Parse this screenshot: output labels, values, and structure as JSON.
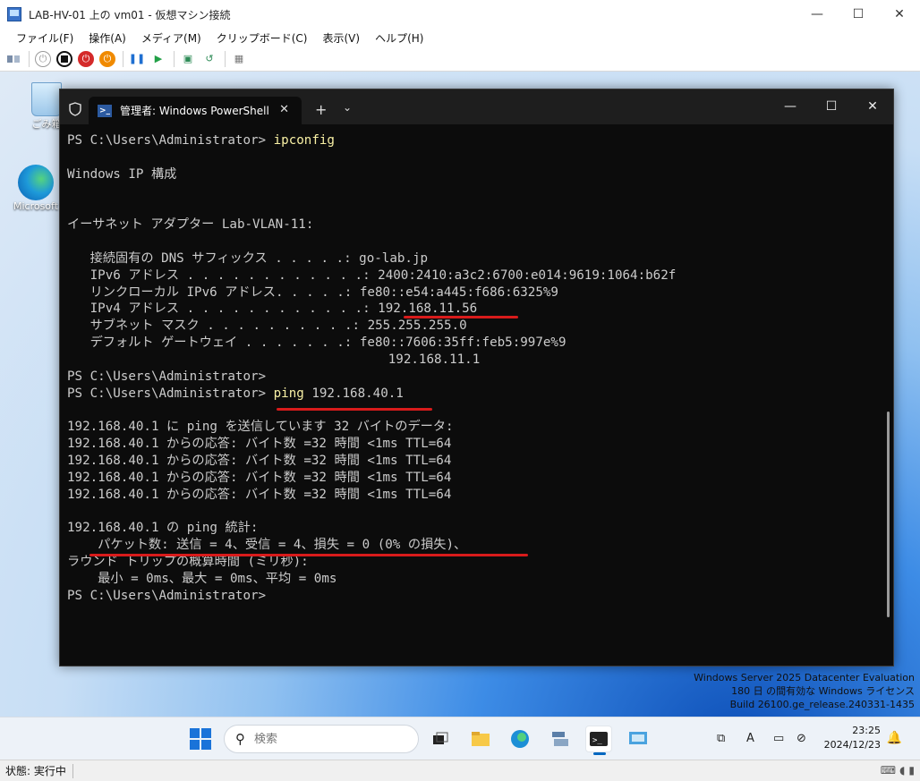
{
  "vm_window": {
    "title": "LAB-HV-01 上の vm01 - 仮想マシン接続",
    "minimize": "—",
    "maximize": "☐",
    "close": "✕",
    "menu": [
      "ファイル(F)",
      "操作(A)",
      "メディア(M)",
      "クリップボード(C)",
      "表示(V)",
      "ヘルプ(H)"
    ]
  },
  "desktop": {
    "recycle_bin_label": "ごみ箱",
    "edge_label": "Microsoft"
  },
  "terminal": {
    "tab_title": "管理者: Windows PowerShell",
    "tab_close": "✕",
    "new_tab": "+",
    "dropdown": "⌄",
    "lines": [
      {
        "prompt": "PS C:\\Users\\Administrator> ",
        "cmd": "ipconfig",
        "rest": ""
      },
      {
        "prompt": "",
        "cmd": "",
        "rest": ""
      },
      {
        "prompt": "",
        "cmd": "",
        "rest": "Windows IP 構成"
      },
      {
        "prompt": "",
        "cmd": "",
        "rest": ""
      },
      {
        "prompt": "",
        "cmd": "",
        "rest": ""
      },
      {
        "prompt": "",
        "cmd": "",
        "rest": "イーサネット アダプター Lab-VLAN-11:"
      },
      {
        "prompt": "",
        "cmd": "",
        "rest": ""
      },
      {
        "prompt": "",
        "cmd": "",
        "rest": "   接続固有の DNS サフィックス . . . . .: go-lab.jp"
      },
      {
        "prompt": "",
        "cmd": "",
        "rest": "   IPv6 アドレス . . . . . . . . . . . .: 2400:2410:a3c2:6700:e014:9619:1064:b62f"
      },
      {
        "prompt": "",
        "cmd": "",
        "rest": "   リンクローカル IPv6 アドレス. . . . .: fe80::e54:a445:f686:6325%9"
      },
      {
        "prompt": "",
        "cmd": "",
        "rest": "   IPv4 アドレス . . . . . . . . . . . .: 192.168.11.56"
      },
      {
        "prompt": "",
        "cmd": "",
        "rest": "   サブネット マスク . . . . . . . . . .: 255.255.255.0"
      },
      {
        "prompt": "",
        "cmd": "",
        "rest": "   デフォルト ゲートウェイ . . . . . . .: fe80::7606:35ff:feb5:997e%9"
      },
      {
        "prompt": "",
        "cmd": "",
        "rest": "                                          192.168.11.1"
      },
      {
        "prompt": "PS C:\\Users\\Administrator>",
        "cmd": "",
        "rest": ""
      },
      {
        "prompt": "PS C:\\Users\\Administrator> ",
        "cmd": "ping",
        "rest": " 192.168.40.1"
      },
      {
        "prompt": "",
        "cmd": "",
        "rest": ""
      },
      {
        "prompt": "",
        "cmd": "",
        "rest": "192.168.40.1 に ping を送信しています 32 バイトのデータ:"
      },
      {
        "prompt": "",
        "cmd": "",
        "rest": "192.168.40.1 からの応答: バイト数 =32 時間 <1ms TTL=64"
      },
      {
        "prompt": "",
        "cmd": "",
        "rest": "192.168.40.1 からの応答: バイト数 =32 時間 <1ms TTL=64"
      },
      {
        "prompt": "",
        "cmd": "",
        "rest": "192.168.40.1 からの応答: バイト数 =32 時間 <1ms TTL=64"
      },
      {
        "prompt": "",
        "cmd": "",
        "rest": "192.168.40.1 からの応答: バイト数 =32 時間 <1ms TTL=64"
      },
      {
        "prompt": "",
        "cmd": "",
        "rest": ""
      },
      {
        "prompt": "",
        "cmd": "",
        "rest": "192.168.40.1 の ping 統計:"
      },
      {
        "prompt": "",
        "cmd": "",
        "rest": "    パケット数: 送信 = 4、受信 = 4、損失 = 0 (0% の損失)、"
      },
      {
        "prompt": "",
        "cmd": "",
        "rest": "ラウンド トリップの概算時間 (ミリ秒):"
      },
      {
        "prompt": "",
        "cmd": "",
        "rest": "    最小 = 0ms、最大 = 0ms、平均 = 0ms"
      },
      {
        "prompt": "PS C:\\Users\\Administrator>",
        "cmd": "",
        "rest": ""
      }
    ]
  },
  "watermark": {
    "line1": "Windows Server 2025 Datacenter Evaluation",
    "line2": "180 日 の間有効な Windows ライセンス",
    "line3": "Build 26100.ge_release.240331-1435"
  },
  "taskbar": {
    "search_placeholder": "検索",
    "time": "23:25",
    "date": "2024/12/23",
    "ime": "A"
  },
  "statusbar": {
    "text": "状態: 実行中"
  },
  "colors": {
    "annotation_underline": "#d81b1b",
    "command_text": "#f9f1a5",
    "terminal_bg": "#0c0c0c"
  }
}
